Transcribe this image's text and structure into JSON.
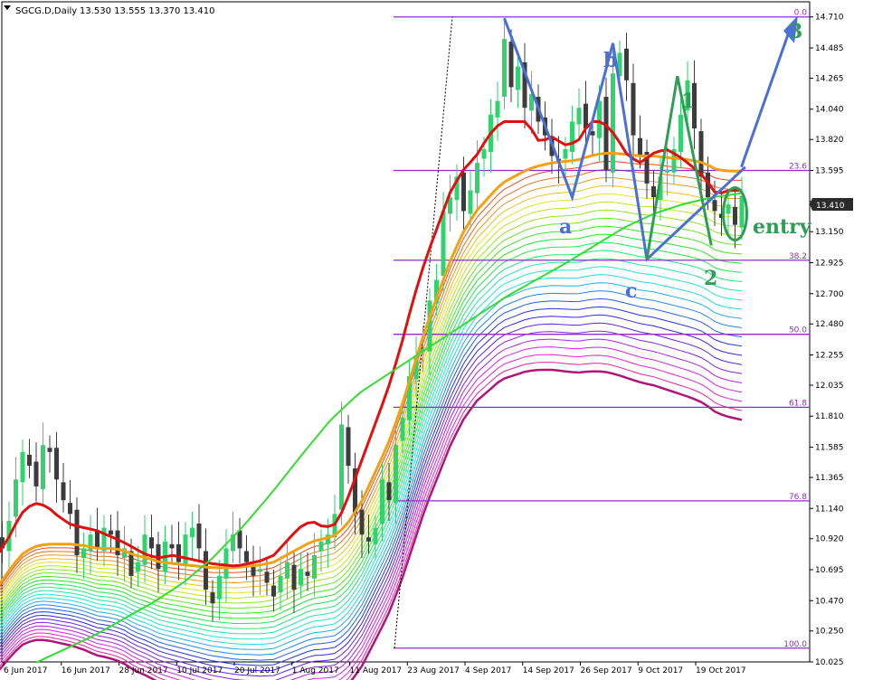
{
  "header": {
    "title": "SGCG.D,Daily",
    "ohlc": "13.530 13.555 13.370 13.410"
  },
  "price_badge": "13.410",
  "annotations": {
    "a": "a",
    "b": "b",
    "c": "c",
    "one": "1",
    "two": "2",
    "three": "3",
    "entry": "entry"
  },
  "colors": {
    "bull_candle": "#32d26e",
    "bear_candle": "#3c3c3c",
    "fib_line": "#8b2fc9",
    "ema_red": "#e01010",
    "ema_orange": "#f5a011",
    "ema_slow": "#33dd33",
    "wave_blue": "#4a6fd8",
    "wave_green": "#2f9e55",
    "price_badge_bg": "#2b2b2b"
  },
  "chart_data": {
    "type": "candlestick",
    "symbol": "SGCG.D",
    "timeframe": "Daily",
    "ylim": [
      10.025,
      14.82
    ],
    "y_ticks": [
      "10.025",
      "10.250",
      "10.470",
      "10.695",
      "10.920",
      "11.140",
      "11.365",
      "11.585",
      "11.810",
      "12.035",
      "12.255",
      "12.480",
      "12.700",
      "12.925",
      "13.150",
      "13.370",
      "13.595",
      "13.820",
      "14.040",
      "14.265",
      "14.485",
      "14.710"
    ],
    "x_ticks": [
      "6 Jun 2017",
      "16 Jun 2017",
      "28 Jun 2017",
      "10 Jul 2017",
      "20 Jul 2017",
      "1 Aug 2017",
      "11 Aug 2017",
      "23 Aug 2017",
      "4 Sep 2017",
      "14 Sep 2017",
      "26 Sep 2017",
      "9 Oct 2017",
      "19 Oct 2017"
    ],
    "fib_levels": [
      {
        "label": "0.0",
        "price": 14.71
      },
      {
        "label": "23.6",
        "price": 13.595
      },
      {
        "label": "38.2",
        "price": 12.943
      },
      {
        "label": "50.0",
        "price": 12.405
      },
      {
        "label": "61.8",
        "price": 11.875
      },
      {
        "label": "76.8",
        "price": 11.195
      },
      {
        "label": "100.0",
        "price": 10.125
      }
    ],
    "closes": [
      10.95,
      10.85,
      11.05,
      11.35,
      11.55,
      11.45,
      11.3,
      11.6,
      11.55,
      11.35,
      11.2,
      11.1,
      10.8,
      10.85,
      10.95,
      10.85,
      11.0,
      10.95,
      10.8,
      10.85,
      10.65,
      10.75,
      10.95,
      10.85,
      10.7,
      10.9,
      10.85,
      10.75,
      10.95,
      11.0,
      10.85,
      10.55,
      10.45,
      10.65,
      10.85,
      10.95,
      10.85,
      10.75,
      10.65,
      10.7,
      10.6,
      10.5,
      10.65,
      10.75,
      10.55,
      10.7,
      10.65,
      10.8,
      10.9,
      10.95,
      11.1,
      11.75,
      11.45,
      11.1,
      10.95,
      10.9,
      11.0,
      11.35,
      11.2,
      11.6,
      11.8,
      12.1,
      12.25,
      12.3,
      12.65,
      12.8,
      13.3,
      13.4,
      13.55,
      13.3,
      13.45,
      13.65,
      13.75,
      14.0,
      14.1,
      14.55,
      14.2,
      14.35,
      14.05,
      14.15,
      13.95,
      13.85,
      13.7,
      13.65,
      13.75,
      13.95,
      14.05,
      13.9,
      13.85,
      14.1,
      13.6,
      14.3,
      14.45,
      14.25,
      13.85,
      13.7,
      13.5,
      13.4,
      13.55,
      13.6,
      13.75,
      14.0,
      14.25,
      13.9,
      13.55,
      13.4,
      13.3,
      13.25,
      13.35,
      13.2,
      13.41
    ],
    "series": [
      {
        "name": "",
        "type": "line",
        "start": 0,
        "end": 110,
        "values": [
          10.78,
          10.92,
          11.1,
          11.18,
          11.16,
          11.08,
          11.02,
          11.0,
          10.98,
          10.94,
          10.9,
          10.85,
          10.8,
          10.78,
          10.8,
          10.78,
          10.76,
          10.74,
          10.73,
          10.72,
          10.74,
          10.76,
          10.8,
          10.9,
          11.0,
          11.05,
          11.0,
          11.03,
          11.25,
          11.5,
          11.75,
          12.0,
          12.3,
          12.65,
          12.95,
          13.2,
          13.45,
          13.6,
          13.7,
          13.85,
          13.95,
          13.95,
          13.95,
          13.8,
          13.84,
          13.78,
          13.8,
          13.95,
          13.95,
          13.85,
          13.7,
          13.65,
          13.72,
          13.75,
          13.7,
          13.63,
          13.55,
          13.42,
          13.45,
          13.45
        ]
      },
      {
        "name": "",
        "type": "line",
        "start": 0,
        "end": 110,
        "values": [
          10.55,
          10.68,
          10.8,
          10.86,
          10.88,
          10.88,
          10.88,
          10.87,
          10.85,
          10.85,
          10.84,
          10.8,
          10.78,
          10.75,
          10.74,
          10.73,
          10.72,
          10.71,
          10.71,
          10.71,
          10.72,
          10.73,
          10.75,
          10.8,
          10.85,
          10.9,
          10.92,
          10.95,
          11.05,
          11.2,
          11.4,
          11.6,
          11.85,
          12.15,
          12.45,
          12.7,
          12.95,
          13.15,
          13.3,
          13.4,
          13.5,
          13.55,
          13.6,
          13.63,
          13.65,
          13.66,
          13.67,
          13.7,
          13.72,
          13.72,
          13.71,
          13.7,
          13.7,
          13.69,
          13.68,
          13.67,
          13.65,
          13.6,
          13.59,
          13.59
        ]
      },
      {
        "name": "",
        "type": "line",
        "start": 6,
        "end": 110,
        "values": [
          10.02,
          10.12,
          10.22,
          10.34,
          10.46,
          10.6,
          10.78,
          11.0,
          11.25,
          11.52,
          11.78,
          11.98,
          12.12,
          12.26,
          12.4,
          12.54,
          12.68,
          12.8,
          12.92,
          13.05,
          13.18,
          13.28,
          13.35,
          13.4,
          13.43
        ]
      }
    ]
  }
}
